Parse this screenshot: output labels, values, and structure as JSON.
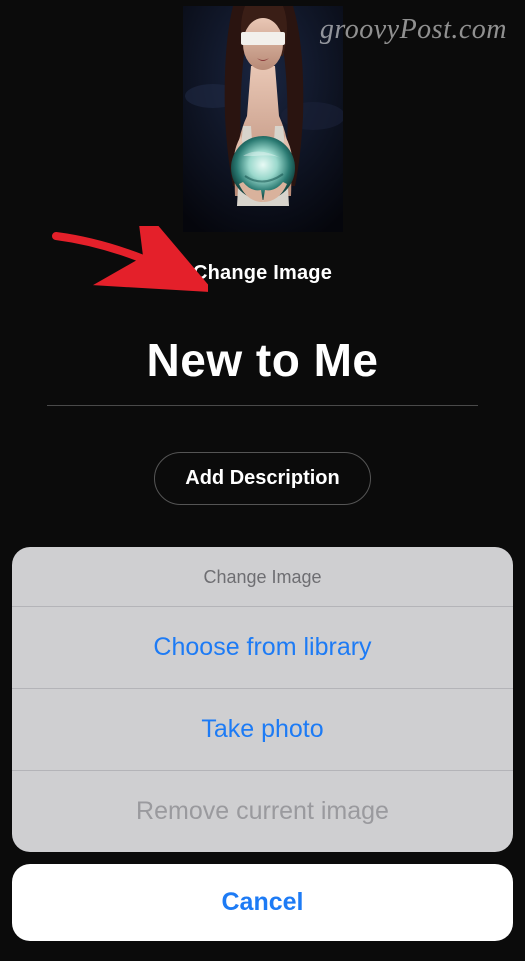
{
  "watermark": "groovyPost.com",
  "editor": {
    "change_image_label": "Change Image",
    "playlist_title": "New to Me",
    "add_description_label": "Add Description"
  },
  "action_sheet": {
    "title": "Change Image",
    "choose_library": "Choose from library",
    "take_photo": "Take photo",
    "remove_current": "Remove current image",
    "cancel": "Cancel"
  }
}
